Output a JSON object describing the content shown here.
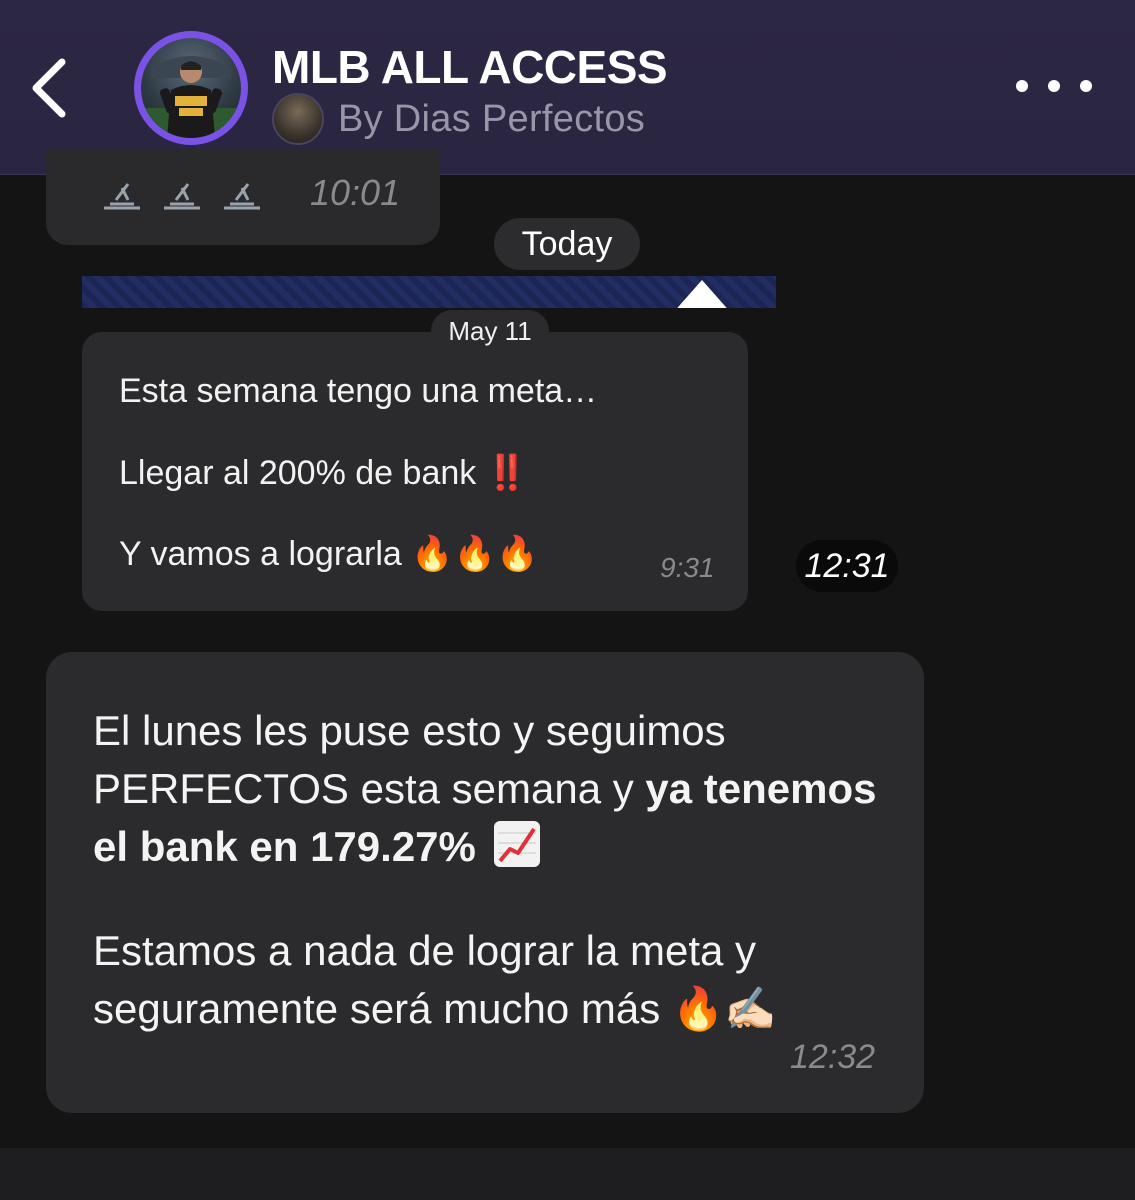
{
  "header": {
    "title": "MLB ALL ACCESS",
    "subtitle": "By Dias Perfectos",
    "back_icon": "chevron-left-icon",
    "more_icon": "more-horizontal-icon",
    "accent_color": "#7b52e6"
  },
  "messages": {
    "top": {
      "icons": "🔌🔌🔌",
      "time": "10:01"
    },
    "date_separator": "Today",
    "forwarded": {
      "date_pill": "May 11",
      "lines": [
        "Esta semana tengo una meta…",
        "Llegar al 200% de bank",
        "Y vamos a lograrla"
      ],
      "line2_emoji": "‼️",
      "line3_emoji": "🔥🔥🔥",
      "time": "9:31"
    },
    "forwarded_time_pill": "12:31",
    "main": {
      "p1_plain": "El lunes les puse esto y seguimos PERFECTOS esta semana y ",
      "p1_bold": "ya tenemos el bank en 179.27%",
      "p2": "Estamos a nada de lograr la meta y seguramente será mucho más",
      "p2_emoji": "🔥✍🏻",
      "time": "12:32"
    }
  }
}
